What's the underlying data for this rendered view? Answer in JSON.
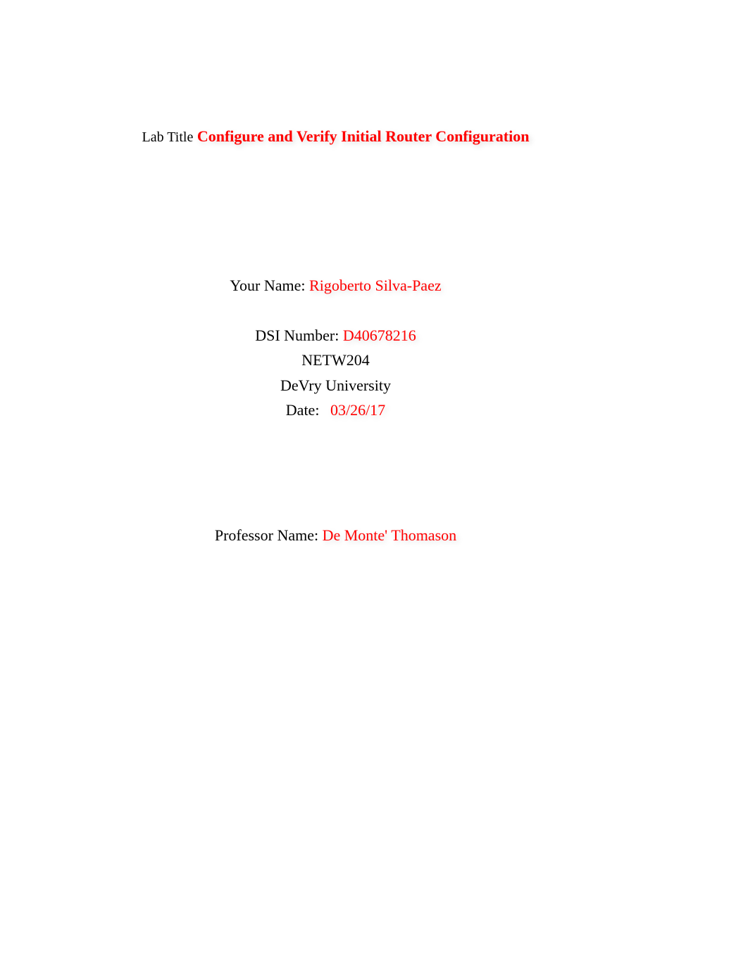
{
  "title": {
    "label": "Lab Title",
    "value": "Configure and Verify Initial Router Configuration"
  },
  "name": {
    "label": "Your Name:",
    "value": "Rigoberto Silva-Paez"
  },
  "dsi": {
    "label": "DSI Number:",
    "value": "D40678216"
  },
  "course": "NETW204",
  "university": "DeVry University",
  "date": {
    "label": "Date:",
    "value": "03/26/17"
  },
  "professor": {
    "label": "Professor Name:",
    "value": "De Monte' Thomason"
  }
}
